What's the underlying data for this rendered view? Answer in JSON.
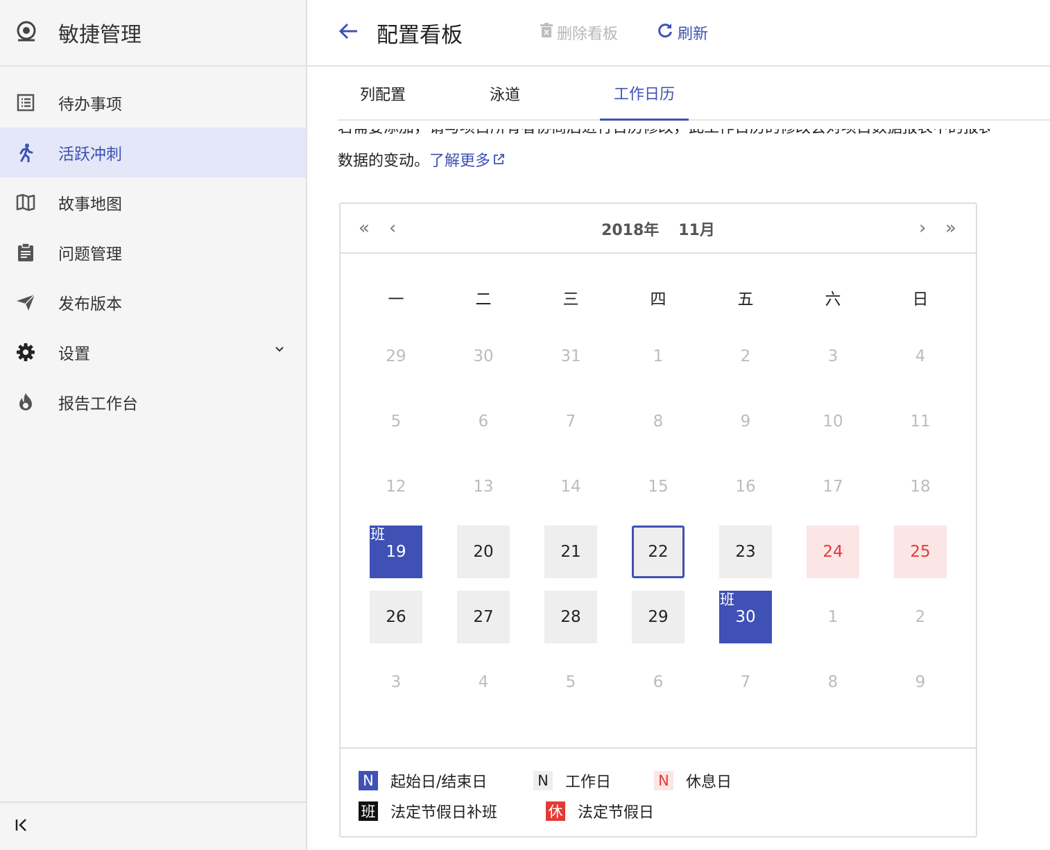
{
  "brand": {
    "title": "敏捷管理"
  },
  "sidebar": {
    "items": [
      {
        "label": "待办事项",
        "icon": "list-icon"
      },
      {
        "label": "活跃冲刺",
        "icon": "run-icon"
      },
      {
        "label": "故事地图",
        "icon": "map-icon"
      },
      {
        "label": "问题管理",
        "icon": "clipboard-icon"
      },
      {
        "label": "发布版本",
        "icon": "send-icon"
      },
      {
        "label": "设置",
        "icon": "gear-icon"
      },
      {
        "label": "报告工作台",
        "icon": "fire-icon"
      }
    ]
  },
  "header": {
    "title": "配置看板",
    "delete_label": "删除看板",
    "refresh_label": "刷新"
  },
  "tabs": [
    "列配置",
    "泳道",
    "工作日历"
  ],
  "description": {
    "partial_line": "若需要添加，请与项目所有者协商后进行日历修改，此工作日历的修改会对项目数据报表中的报表",
    "line": "数据的变动。",
    "link": "了解更多"
  },
  "calendar": {
    "year": "2018年",
    "month": "11月",
    "nav": {
      "prev_year": "«",
      "prev_month": "‹",
      "next_month": "›",
      "next_year": "»"
    },
    "weekdays": [
      "一",
      "二",
      "三",
      "四",
      "五",
      "六",
      "日"
    ],
    "weeks": [
      [
        {
          "d": "29",
          "t": "out"
        },
        {
          "d": "30",
          "t": "out"
        },
        {
          "d": "31",
          "t": "out"
        },
        {
          "d": "1",
          "t": "out"
        },
        {
          "d": "2",
          "t": "out"
        },
        {
          "d": "3",
          "t": "out"
        },
        {
          "d": "4",
          "t": "out"
        }
      ],
      [
        {
          "d": "5",
          "t": "out"
        },
        {
          "d": "6",
          "t": "out"
        },
        {
          "d": "7",
          "t": "out"
        },
        {
          "d": "8",
          "t": "out"
        },
        {
          "d": "9",
          "t": "out"
        },
        {
          "d": "10",
          "t": "out"
        },
        {
          "d": "11",
          "t": "out"
        }
      ],
      [
        {
          "d": "12",
          "t": "out"
        },
        {
          "d": "13",
          "t": "out"
        },
        {
          "d": "14",
          "t": "out"
        },
        {
          "d": "15",
          "t": "out"
        },
        {
          "d": "16",
          "t": "out"
        },
        {
          "d": "17",
          "t": "out"
        },
        {
          "d": "18",
          "t": "out"
        }
      ],
      [
        {
          "d": "19",
          "t": "start",
          "badge": "班"
        },
        {
          "d": "20",
          "t": "work"
        },
        {
          "d": "21",
          "t": "work"
        },
        {
          "d": "22",
          "t": "today"
        },
        {
          "d": "23",
          "t": "work"
        },
        {
          "d": "24",
          "t": "rest"
        },
        {
          "d": "25",
          "t": "rest"
        }
      ],
      [
        {
          "d": "26",
          "t": "work"
        },
        {
          "d": "27",
          "t": "work"
        },
        {
          "d": "28",
          "t": "work"
        },
        {
          "d": "29",
          "t": "work"
        },
        {
          "d": "30",
          "t": "start",
          "badge": "班"
        },
        {
          "d": "1",
          "t": "out"
        },
        {
          "d": "2",
          "t": "out"
        }
      ],
      [
        {
          "d": "3",
          "t": "out"
        },
        {
          "d": "4",
          "t": "out"
        },
        {
          "d": "5",
          "t": "out"
        },
        {
          "d": "6",
          "t": "out"
        },
        {
          "d": "7",
          "t": "out"
        },
        {
          "d": "8",
          "t": "out"
        },
        {
          "d": "9",
          "t": "out"
        }
      ]
    ]
  },
  "legend": [
    {
      "symbol": "N",
      "label": "起始日/结束日",
      "style": "start"
    },
    {
      "symbol": "N",
      "label": "工作日",
      "style": "work"
    },
    {
      "symbol": "N",
      "label": "休息日",
      "style": "rest"
    },
    {
      "symbol": "班",
      "label": "法定节假日补班",
      "style": "holiday-work"
    },
    {
      "symbol": "休",
      "label": "法定节假日",
      "style": "holiday"
    }
  ],
  "colors": {
    "accent": "#3f51b5",
    "rest_text": "#e53935",
    "rest_bg": "#fbe5e5",
    "work_bg": "#eeeeee"
  }
}
